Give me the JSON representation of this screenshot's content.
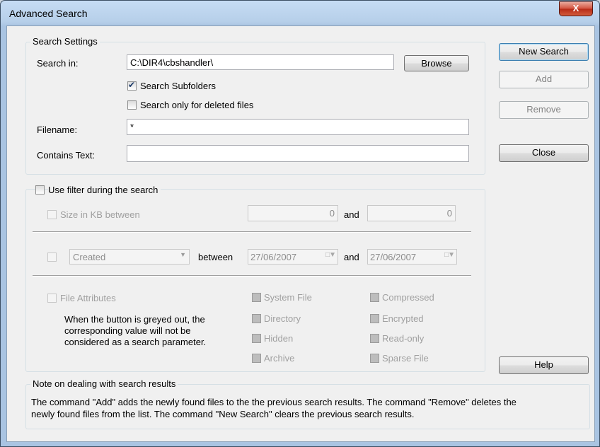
{
  "window": {
    "title": "Advanced Search",
    "close_glyph": "X"
  },
  "search_settings": {
    "title": "Search Settings",
    "search_in_label": "Search in:",
    "search_in_value": "C:\\DIR4\\cbshandler\\",
    "browse_label": "Browse",
    "subfolders_label": "Search Subfolders",
    "subfolders_checked": true,
    "deleted_label": "Search only for deleted files",
    "deleted_checked": false,
    "filename_label": "Filename:",
    "filename_value": "*",
    "contains_label": "Contains Text:",
    "contains_value": ""
  },
  "filter": {
    "use_filter_label": "Use filter during the search",
    "size_label": "Size in KB between",
    "size_min": "0",
    "size_and": "and",
    "size_max": "0",
    "date_type": "Created",
    "between_label": "between",
    "date_from": "27/06/2007",
    "date_and": "and",
    "date_to": "27/06/2007",
    "attributes_label": "File Attributes",
    "attributes_note_1": "When the button is greyed out, the",
    "attributes_note_2": "corresponding value will not be",
    "attributes_note_3": "considered as a search parameter.",
    "attributes": {
      "system_file": "System File",
      "compressed": "Compressed",
      "directory": "Directory",
      "encrypted": "Encrypted",
      "hidden": "Hidden",
      "read_only": "Read-only",
      "archive": "Archive",
      "sparse_file": "Sparse File"
    }
  },
  "buttons": {
    "new_search": "New Search",
    "add": "Add",
    "remove": "Remove",
    "close": "Close",
    "help": "Help"
  },
  "note": {
    "title": "Note on dealing with search results",
    "line1": "The command \"Add\" adds the newly found files to the the previous search results. The command \"Remove\" deletes the",
    "line2": "newly found files from the list. The command \"New Search\" clears the previous search results."
  }
}
